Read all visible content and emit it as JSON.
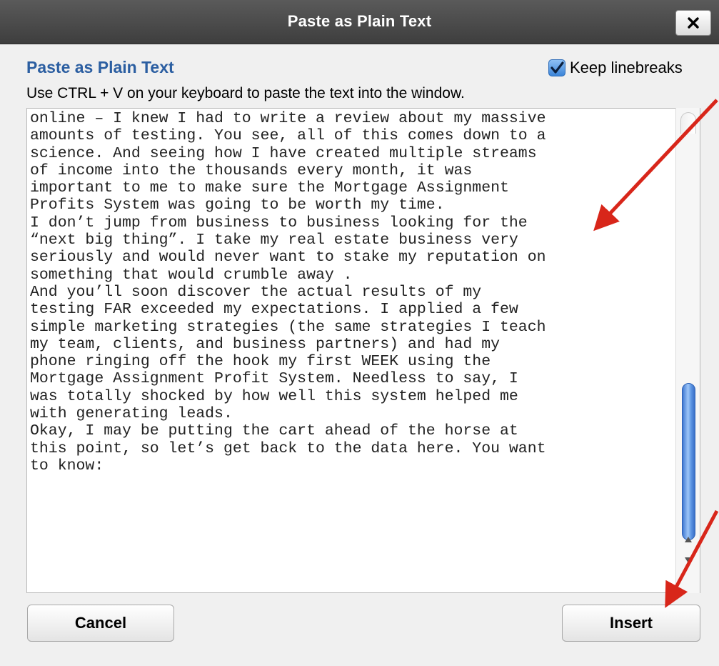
{
  "window": {
    "title": "Paste as Plain Text",
    "close_label": "X"
  },
  "dialog": {
    "heading": "Paste as Plain Text",
    "keep_linebreaks_label": "Keep linebreaks",
    "keep_linebreaks_checked": true,
    "instructions": "Use CTRL + V on your keyboard to paste the text into the window.",
    "text_lines": [
      "online – I knew I had to write a review about my massive",
      "amounts of testing. You see, all of this comes down to a",
      "science. And seeing how I have created multiple streams",
      "of income into the thousands every month, it was",
      "important to me to make sure the Mortgage Assignment",
      "Profits System was going to be worth my time.",
      "I don’t jump from business to business looking for the",
      "“next big thing”. I take my real estate business very",
      "seriously and would never want to stake my reputation on",
      "something that would crumble away .",
      "And you’ll soon discover the actual results of my",
      "testing FAR exceeded my expectations. I applied a few",
      "simple marketing strategies (the same strategies I teach",
      "my team, clients, and business partners) and had my",
      "phone ringing off the hook my first WEEK using the",
      "Mortgage Assignment Profit System. Needless to say, I",
      "was totally shocked by how well this system helped me",
      "with generating leads.",
      "Okay, I may be putting the cart ahead of the horse at",
      "this point, so let’s get back to the data here. You want",
      "to know:"
    ],
    "cancel_label": "Cancel",
    "insert_label": "Insert"
  },
  "colors": {
    "heading": "#2b5ea1",
    "titlebar": "#4a4a4a",
    "annotation_arrow": "#d8261a"
  },
  "icons": {
    "close": "close-icon",
    "check": "checkmark-icon",
    "scroll_up": "scroll-up-arrow-icon",
    "scroll_down": "scroll-down-arrow-icon"
  }
}
